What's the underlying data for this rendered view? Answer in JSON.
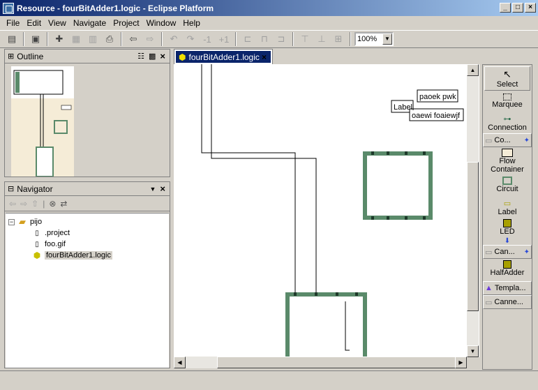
{
  "window": {
    "title": "Resource - fourBitAdder1.logic - Eclipse Platform",
    "buttons": [
      "_",
      "□",
      "×"
    ]
  },
  "menu": [
    "File",
    "Edit",
    "View",
    "Navigate",
    "Project",
    "Window",
    "Help"
  ],
  "toolbar": {
    "zoom": "100%",
    "icons": [
      "new-icon",
      "open-icon",
      "save-icon",
      "save-all-icon",
      "print-icon",
      "back-icon",
      "forward-icon",
      "undo-icon",
      "redo-icon",
      "minus-one-icon",
      "plus-one-icon",
      "align-left-icon",
      "align-center-icon",
      "align-right-icon",
      "match-width-icon",
      "match-height-icon"
    ],
    "minus_label": "-1",
    "plus_label": "+1"
  },
  "outline": {
    "title": "Outline"
  },
  "navigator": {
    "title": "Navigator",
    "tree": [
      {
        "name": "pijo",
        "type": "folder",
        "level": 0
      },
      {
        "name": ".project",
        "type": "file",
        "level": 1
      },
      {
        "name": "foo.gif",
        "type": "file",
        "level": 1
      },
      {
        "name": "fourBitAdder1.logic",
        "type": "logic",
        "level": 1,
        "selected": true
      }
    ]
  },
  "editor": {
    "tab_label": "fourBitAdder1.logic",
    "labels": {
      "label1": "Label",
      "label2": "paoek pwk",
      "label3": "oaewi foaiewjf"
    }
  },
  "palette": {
    "select": "Select",
    "marquee": "Marquee",
    "connection": "Connection",
    "drawer_components": "Co...",
    "flow_container": "Flow Container",
    "circuit": "Circuit",
    "label": "Label",
    "led": "LED",
    "drawer_canned": "Can...",
    "halfadder": "HalfAdder",
    "drawer_templates": "Templa...",
    "drawer_canned2": "Canne..."
  },
  "colors": {
    "title_gradient_start": "#0a246a",
    "title_gradient_end": "#a6caf0",
    "circuit_border": "#5a8a6a"
  }
}
